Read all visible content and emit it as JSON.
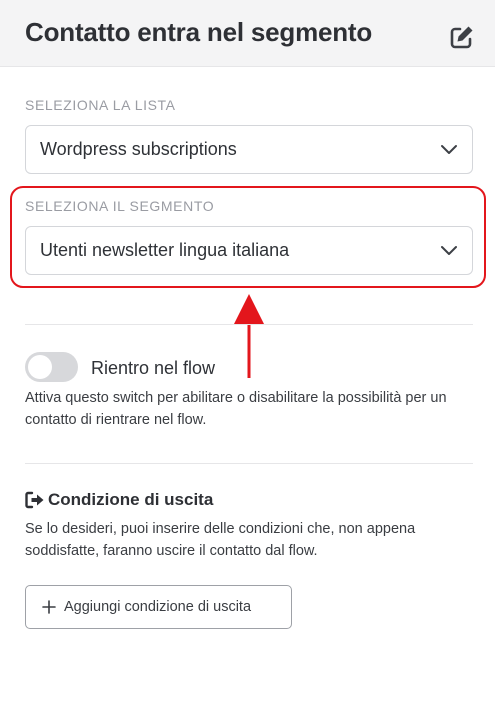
{
  "header": {
    "title": "Contatto entra nel segmento",
    "edit_icon": "edit-icon"
  },
  "list_section": {
    "label": "SELEZIONA LA LISTA",
    "selected": "Wordpress subscriptions",
    "chevron_icon": "chevron-down-icon"
  },
  "segment_section": {
    "label": "SELEZIONA IL SEGMENTO",
    "selected": "Utenti newsletter lingua italiana",
    "chevron_icon": "chevron-down-icon",
    "annotation_color": "#e3161c"
  },
  "reentry": {
    "label": "Rientro nel flow",
    "enabled": false,
    "description": "Attiva questo switch per abilitare o disabilitare la possibilità per un contatto di rientrare nel flow."
  },
  "exit_condition": {
    "icon": "sign-out-icon",
    "title": "Condizione di uscita",
    "description": "Se lo desideri, puoi inserire delle condizioni che, non appena soddisfatte, faranno uscire il contatto dal flow.",
    "add_button_label": "Aggiungi condizione di uscita",
    "add_icon": "plus-icon"
  }
}
